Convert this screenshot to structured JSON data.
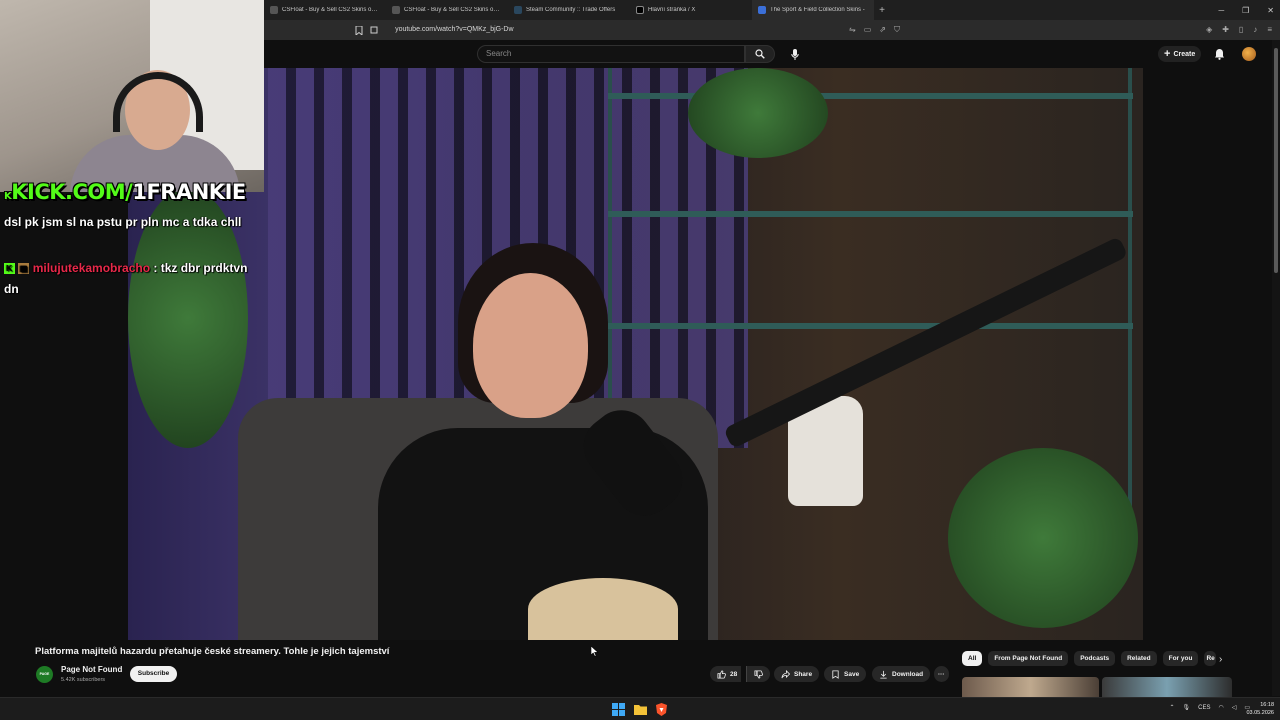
{
  "browser": {
    "tabs": [
      {
        "label": "CSFloat - Buy & Sell CS2 Skins on the",
        "icon": "csfloat-icon"
      },
      {
        "label": "CSFloat - Buy & Sell CS2 Skins on the",
        "icon": "csfloat-icon"
      },
      {
        "label": "Steam Community :: Trade Offers",
        "icon": "steam-icon"
      },
      {
        "label": "Hlavní stránka / X",
        "icon": "x-icon"
      },
      {
        "label": "The Sport & Field Collection Skins -",
        "icon": "tab-icon"
      }
    ],
    "new_tab": "+",
    "url": "youtube.com/watch?v=QMKz_bjG-Dw"
  },
  "youtube": {
    "search_placeholder": "Search",
    "create_label": "Create",
    "video_title": "Platforma majitelů hazardu přetahuje české streamery. Tohle je jejich tajemství",
    "channel": {
      "name": "Page Not Found",
      "subscribers": "5.42K subscribers",
      "avatar_text": "PAGE NOT FOUND",
      "subscribe_label": "Subscribe"
    },
    "actions": {
      "likes": "28",
      "share": "Share",
      "save": "Save",
      "download": "Download",
      "more": "···"
    },
    "chips": [
      "All",
      "From Page Not Found",
      "Podcasts",
      "Related",
      "For you",
      "Re"
    ]
  },
  "stream_overlay": {
    "kick_prefix": "KICK.COM/",
    "kick_name": "1FRANKIE",
    "chat": [
      {
        "user": "",
        "message": "dsl pk jsm sl na pstu pr pln mc a tdka chll"
      },
      {
        "user": "milujutekamobracho",
        "message": ": tkz dbr prdktvn dn"
      }
    ]
  },
  "taskbar": {
    "language": "CES",
    "time": "16:18",
    "date": "03.05.2026"
  },
  "colors": {
    "kick_green": "#53fc18",
    "chat_user_red": "#e8294a",
    "yt_background": "#0f0f0f"
  }
}
